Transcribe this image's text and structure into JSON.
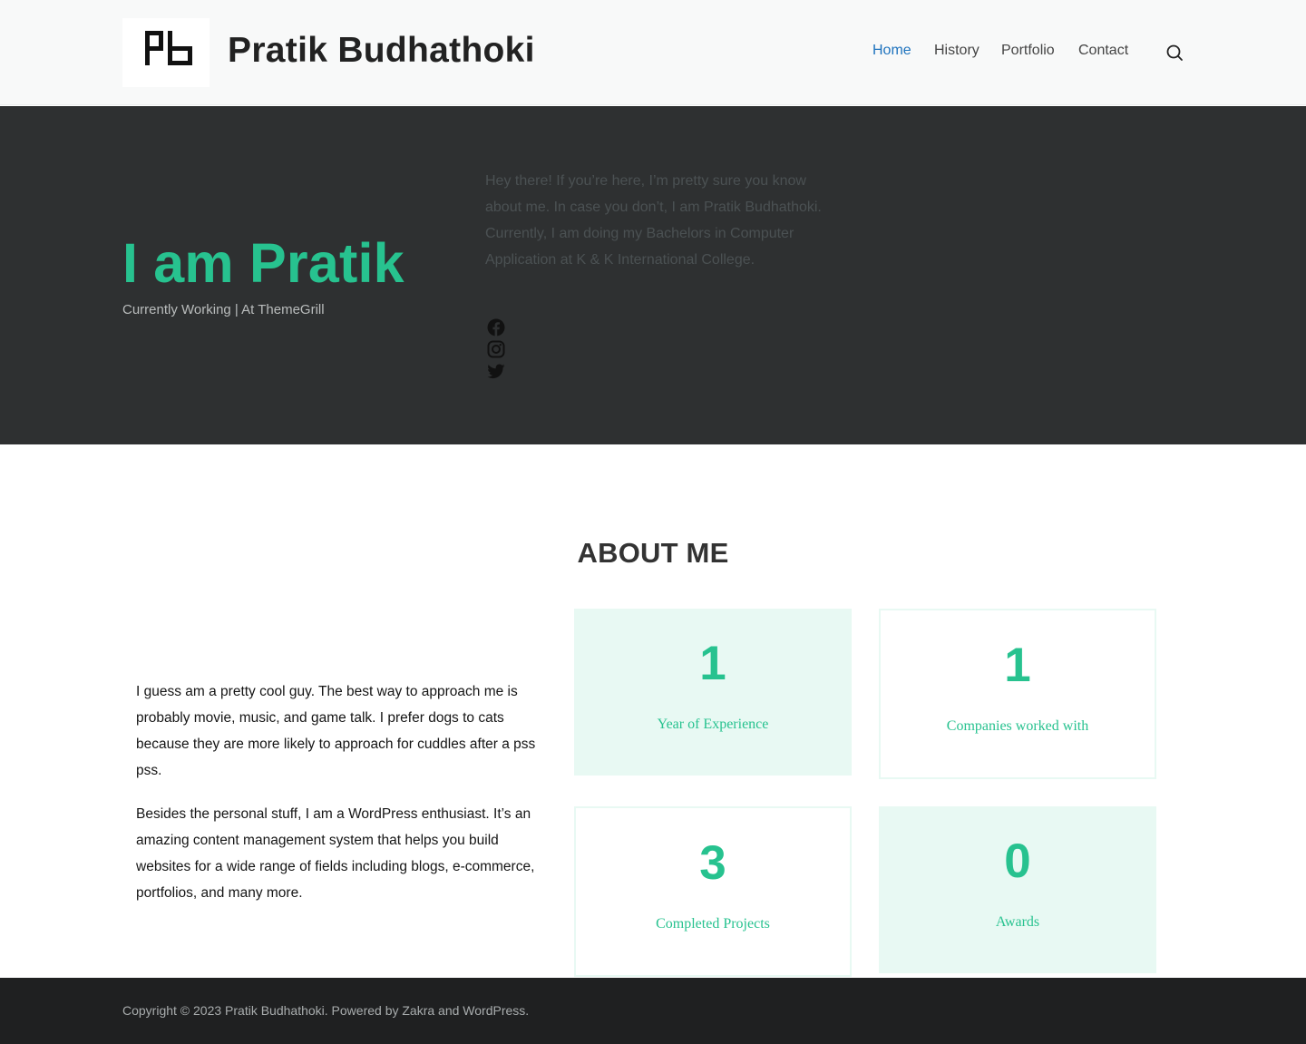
{
  "header": {
    "logo_text": "Pb",
    "site_title": "Pratik Budhathoki",
    "nav": [
      {
        "label": "Home",
        "active": true
      },
      {
        "label": "History",
        "active": false
      },
      {
        "label": "Portfolio",
        "active": false
      },
      {
        "label": "Contact",
        "active": false
      }
    ],
    "search_icon": "search-icon"
  },
  "hero": {
    "heading": "I am Pratik",
    "subheading": "Currently Working | At ThemeGrill",
    "intro": "Hey there! If you’re here, I’m pretty sure you know about me. In case you don’t, I am Pratik Budhathoki. Currently, I am doing my Bachelors in Computer Application at K & K International College.",
    "social_icons": [
      "facebook-icon",
      "instagram-icon",
      "twitter-icon"
    ]
  },
  "about": {
    "title": "ABOUT ME",
    "paragraphs": [
      "I guess am a pretty cool guy. The best way to approach me is probably movie, music, and game talk. I prefer dogs to cats because they are more likely to approach for cuddles after a pss pss.",
      "Besides the personal stuff, I am a WordPress enthusiast. It’s an amazing content management system that helps you build websites for a wide range of fields including blogs, e-commerce, portfolios, and many more."
    ],
    "stats": [
      {
        "number": "1",
        "label": "Year of Experience"
      },
      {
        "number": "1",
        "label": "Companies worked with"
      },
      {
        "number": "3",
        "label": "Completed Projects"
      },
      {
        "number": "0",
        "label": "Awards"
      }
    ]
  },
  "footer": {
    "copyright": "Copyright © 2023 Pratik Budhathoki. Powered by Zakra and WordPress."
  },
  "colors": {
    "accent": "#27c28f",
    "nav_active": "#1e73be",
    "hero_bg": "#2e3031",
    "footer_bg": "#1f2021",
    "stat_fill": "#e8f9f3"
  }
}
